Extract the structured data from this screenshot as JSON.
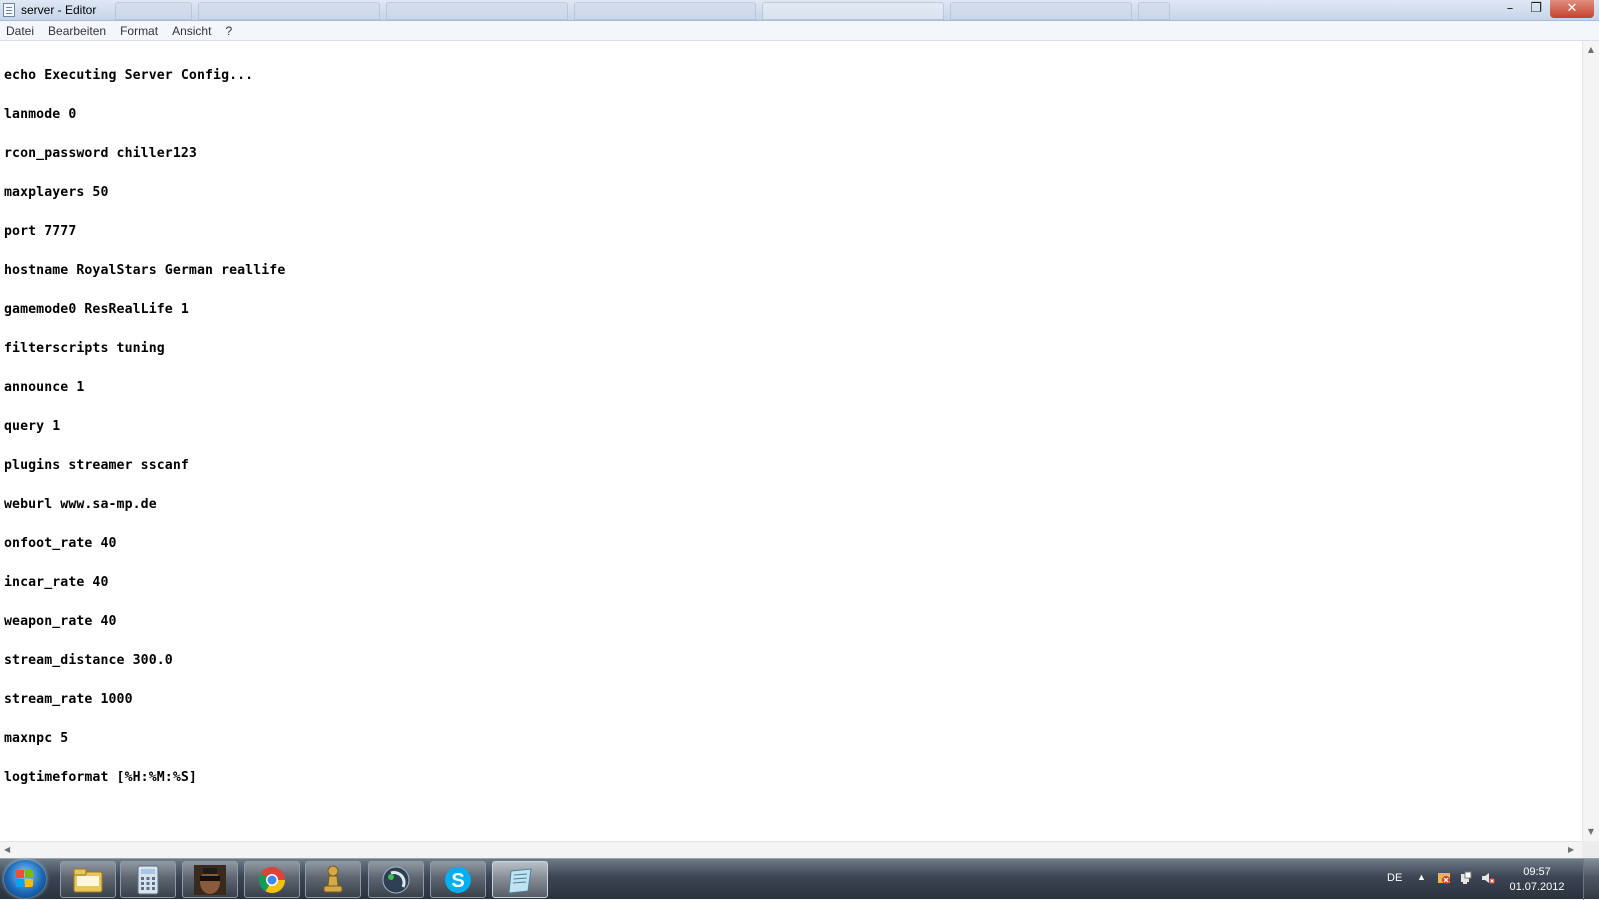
{
  "window": {
    "title": "server - Editor",
    "controls": {
      "minimize": "–",
      "maximize": "❐",
      "close": "✕"
    }
  },
  "menu": [
    "Datei",
    "Bearbeiten",
    "Format",
    "Ansicht",
    "?"
  ],
  "editor": {
    "lines": [
      "echo Executing Server Config...",
      "lanmode 0",
      "rcon_password chiller123",
      "maxplayers 50",
      "port 7777",
      "hostname RoyalStars German reallife",
      "gamemode0 ResRealLife 1",
      "filterscripts tuning",
      "announce 1",
      "query 1",
      "plugins streamer sscanf",
      "weburl www.sa-mp.de",
      "onfoot_rate 40",
      "incar_rate 40",
      "weapon_rate 40",
      "stream_distance 300.0",
      "stream_rate 1000",
      "maxnpc 5",
      "logtimeformat [%H:%M:%S]"
    ]
  },
  "taskbar": {
    "pinned": [
      {
        "name": "windows-explorer-icon",
        "active": false
      },
      {
        "name": "calculator-icon",
        "active": false
      },
      {
        "name": "gta-san-andreas-icon",
        "active": false
      },
      {
        "name": "chrome-icon",
        "active": false
      },
      {
        "name": "chess-pawn-icon",
        "active": false
      },
      {
        "name": "media-player-icon",
        "active": false
      },
      {
        "name": "skype-icon",
        "active": false
      },
      {
        "name": "notepad-icon",
        "active": true
      }
    ],
    "tray": {
      "language": "DE",
      "time": "09:57",
      "date": "01.07.2012"
    }
  },
  "colors": {
    "start_orb": "#1d69b8",
    "taskbar": "#3c4552",
    "close_button": "#c4432d",
    "skype": "#00aff0"
  }
}
